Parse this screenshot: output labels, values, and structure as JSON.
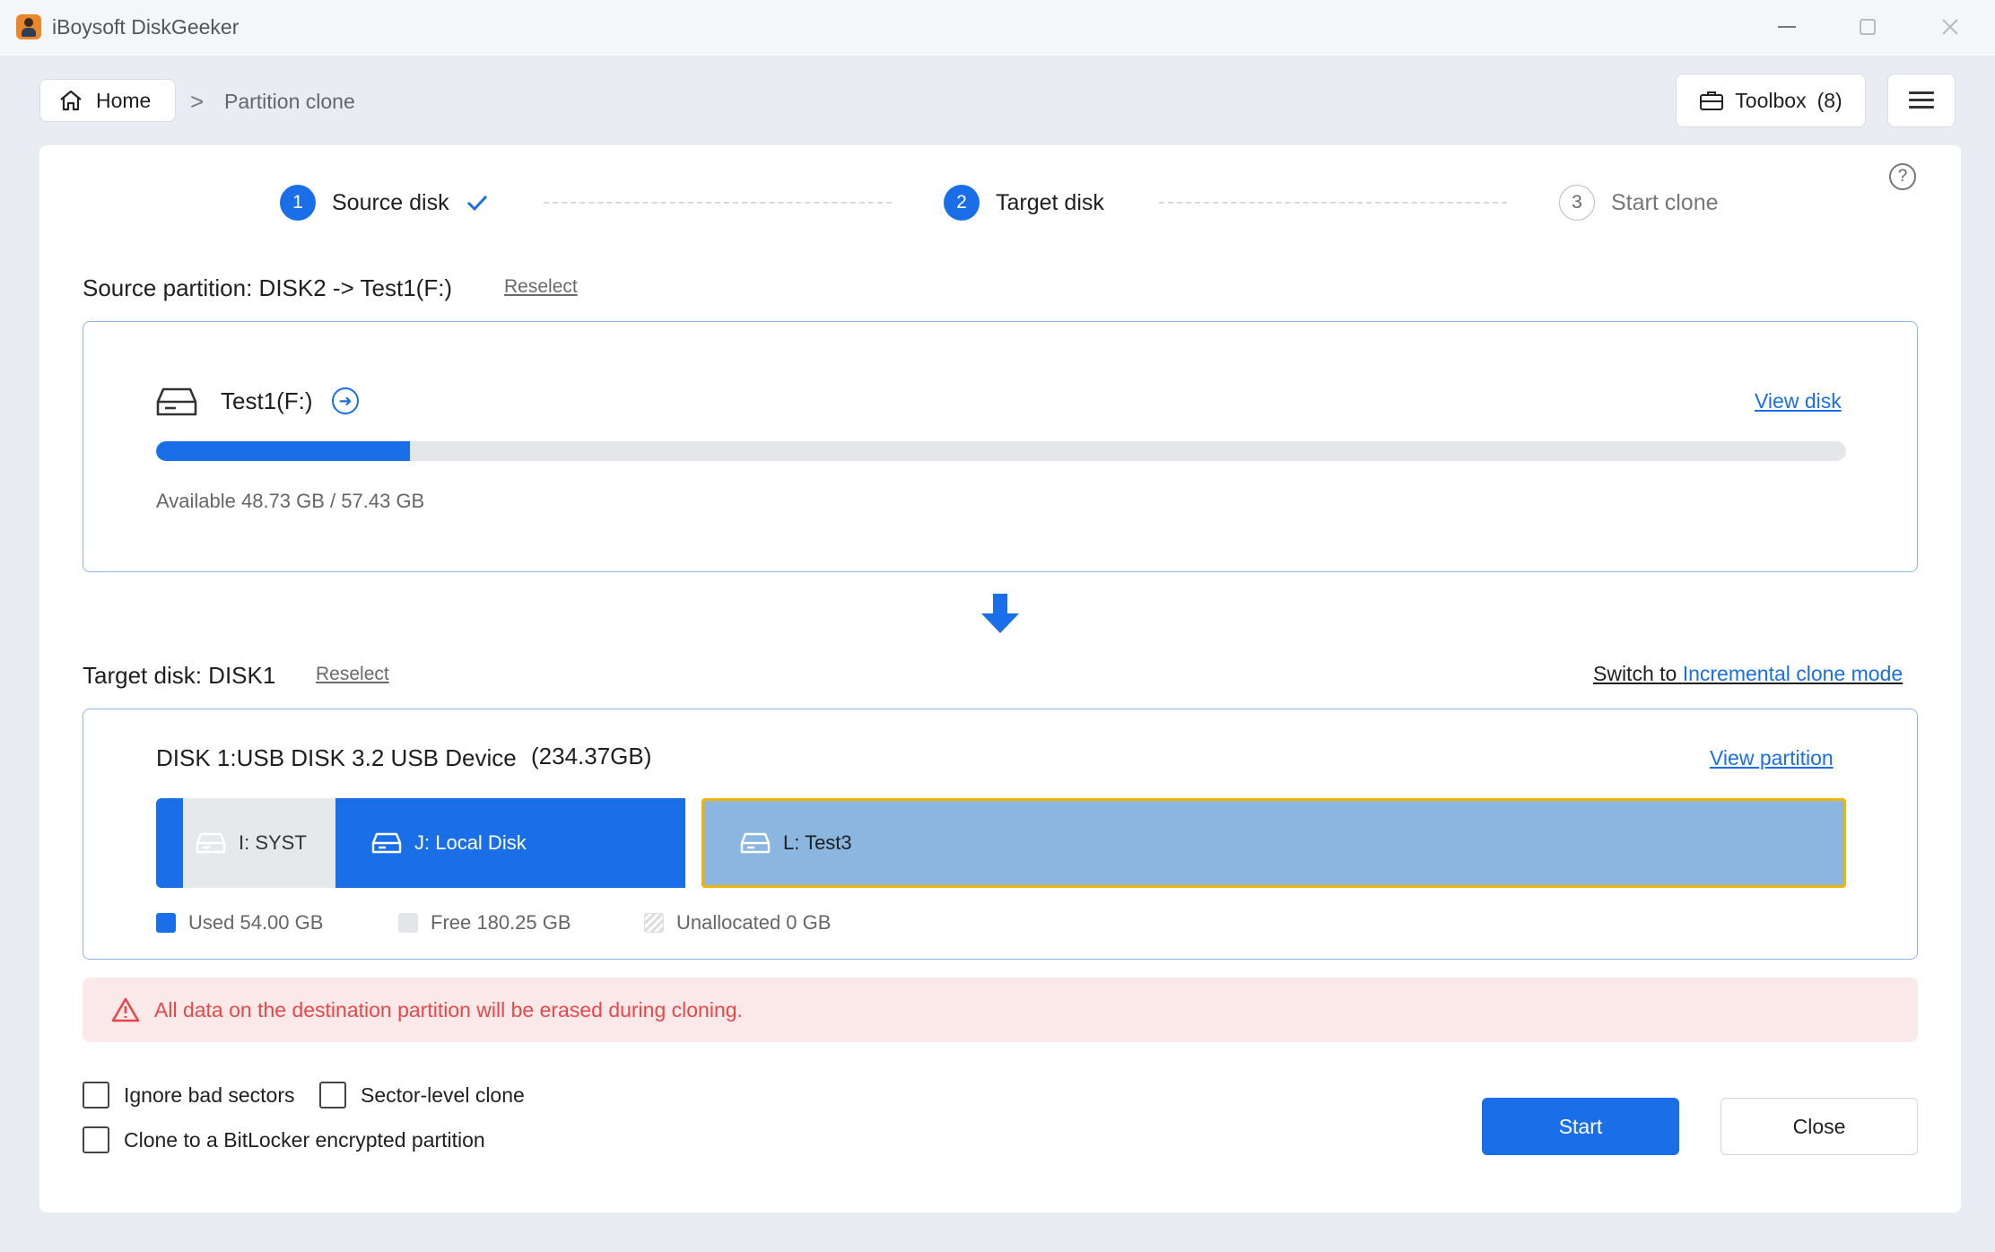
{
  "window": {
    "title": "iBoysoft DiskGeeker"
  },
  "nav": {
    "home_label": "Home",
    "separator": ">",
    "current": "Partition clone",
    "toolbox_label": "Toolbox",
    "toolbox_count": "(8)"
  },
  "help": "?",
  "steps": [
    {
      "num": "1",
      "label": "Source disk",
      "state": "done"
    },
    {
      "num": "2",
      "label": "Target disk",
      "state": "active"
    },
    {
      "num": "3",
      "label": "Start clone",
      "state": "pending"
    }
  ],
  "source": {
    "heading": "Source partition: DISK2 -> Test1(F:)",
    "reselect": "Reselect",
    "partition_name": "Test1(F:)",
    "view_disk": "View disk",
    "used_fraction": 0.15,
    "available_text": "Available 48.73 GB / 57.43 GB"
  },
  "target": {
    "heading": "Target disk: DISK1",
    "reselect": "Reselect",
    "switch_prefix": "Switch to ",
    "switch_link": "Incremental clone mode",
    "disk_name": "DISK 1:USB DISK 3.2 USB Device",
    "disk_size": "(234.37GB)",
    "view_partition": "View partition",
    "partitions": [
      {
        "label": "I: SYST"
      },
      {
        "label": "J: Local Disk"
      },
      {
        "label": "L: Test3",
        "selected": true
      }
    ],
    "legend": {
      "used": "Used 54.00 GB",
      "free": "Free 180.25 GB",
      "unallocated": "Unallocated 0 GB"
    }
  },
  "warning": "All data on the destination partition will be erased during cloning.",
  "options": {
    "ignore_bad_sectors": "Ignore bad sectors",
    "sector_level_clone": "Sector-level clone",
    "bitlocker": "Clone to a BitLocker encrypted partition"
  },
  "buttons": {
    "start": "Start",
    "close": "Close"
  },
  "colors": {
    "accent": "#1a6fe8",
    "warning_text": "#e54848",
    "warning_bg": "#fbe9ea",
    "selected_border": "#f0b400",
    "selected_partition": "#8ab6e0"
  },
  "icons": {
    "home": "home-icon",
    "toolbox": "briefcase-icon",
    "menu": "hamburger-icon",
    "drive": "drive-icon",
    "goto": "arrow-right-circle-icon",
    "arrow": "arrow-down-icon",
    "warning": "warning-triangle-icon"
  }
}
